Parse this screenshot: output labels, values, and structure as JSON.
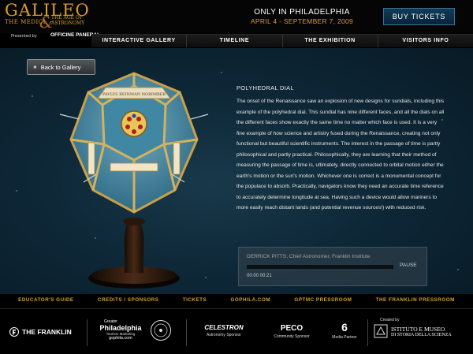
{
  "header": {
    "logo_main": "GALILEO",
    "logo_ampersand": "&",
    "logo_sub_left": "THE MEDICI",
    "logo_sub_right": "THE AGE OF ASTRONOMY",
    "presented_by": "Presented by",
    "sponsor_logo": "OFFICINE PANERAI",
    "only_in": "ONLY IN PHILADELPHIA",
    "date_range": "APRIL 4 - SEPTEMBER 7, 2009",
    "buy_tickets_label": "BUY TICKETS"
  },
  "nav": {
    "items": [
      {
        "label": "INTERACTIVE GALLERY"
      },
      {
        "label": "TIMELINE"
      },
      {
        "label": "THE EXHIBITION"
      },
      {
        "label": "VISITORS INFO"
      }
    ]
  },
  "main": {
    "back_label": "Back to Gallery",
    "back_icon": "star-icon",
    "object_title": "POLYHEDRAL DIAL",
    "object_description": "The onset of the Renaissance saw an explosion of new designs for sundials, including this example of the polyhedral dial.  This sundial has nine different faces, and all the dials on all the different faces show exactly the same time no matter which face is used. It is a very fine example of how science and artistry fused during the Renaissance, creating not only functional but beautiful scientific instruments. The interest in the passage of time is partly philosophical and partly practical. Philosophically, they are learning that their method of measuring the passage of time is, ultimately, directly connected to orbital motion  either the earth's motion or the sun's motion. Whichever one is correct is a monumental concept for the populace to absorb. Practically, navigators know they need an accurate time reference to accurately determine longitude at sea. Having such a device would allow mariners to more easily reach distant lands (and potential revenue sources!) with reduced risk.",
    "artifact_label": "Polyhedral dial",
    "artifact_inscription": "PAVLVS REINMAN NORIMBER"
  },
  "player": {
    "caption": "DERRICK PITTS, Chief Astronomer, Franklin Institute",
    "pause_label": "PAUSE",
    "time_readout": "00:00 00:21",
    "progress_fraction": 0
  },
  "footer": {
    "links": [
      {
        "label": "EDUCATOR'S GUIDE"
      },
      {
        "label": "CREDITS / SPONSORS"
      },
      {
        "label": "TICKETS"
      },
      {
        "label": "GOPHILA.COM"
      },
      {
        "label": "GPTMC PRESSROOM"
      },
      {
        "label": "THE FRANKLIN PRESSROOM"
      }
    ],
    "sponsors": {
      "franklin": {
        "name": "THE FRANKLIN"
      },
      "philadelphia": {
        "top": "Greater",
        "name": "Philadelphia",
        "sub": "Tourism Marketing",
        "url": "gophila.com"
      },
      "celestron": {
        "name": "CELESTRON",
        "role": "Astronomy Sponsor"
      },
      "peco": {
        "name": "PECO",
        "role": "Community Sponsor"
      },
      "channel6": {
        "name": "6",
        "role": "Media Partner"
      },
      "museo": {
        "created_by": "Created by",
        "name": "ISTITUTO E MUSEO",
        "sub": "DI STORIA DELLA SCIENZA"
      }
    }
  }
}
